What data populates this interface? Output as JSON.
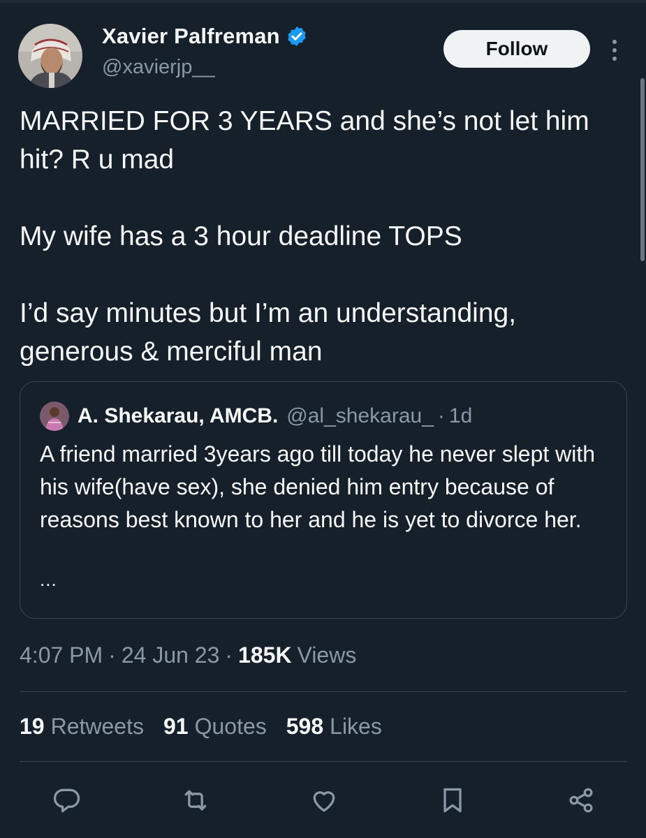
{
  "author": {
    "display_name": "Xavier Palfreman",
    "handle": "@xavierjp__",
    "verified_icon": "verified-badge-icon",
    "avatar": "profile-photo"
  },
  "header": {
    "follow_label": "Follow",
    "more_icon": "more-vertical-icon"
  },
  "tweet": {
    "text": "MARRIED FOR 3 YEARS and she’s not let him hit? R u mad\n\nMy wife has a 3 hour deadline TOPS\n\nI’d say minutes but I’m an understanding, generous & merciful man"
  },
  "quote": {
    "display_name": "A. Shekarau, AMCB.",
    "handle": "@al_shekarau_",
    "separator": "·",
    "time": "1d",
    "text": "A friend married 3years ago till today he never slept with his wife(have sex), she denied him entry because of reasons best known to her and he is yet to divorce her.",
    "ellipsis": "..."
  },
  "meta": {
    "time": "4:07 PM",
    "separator": "·",
    "date": "24 Jun 23",
    "views_count": "185K",
    "views_label": "Views"
  },
  "stats": {
    "retweets_count": "19",
    "retweets_label": "Retweets",
    "quotes_count": "91",
    "quotes_label": "Quotes",
    "likes_count": "598",
    "likes_label": "Likes"
  },
  "actions": [
    "reply-icon",
    "retweet-icon",
    "like-icon",
    "bookmark-icon",
    "share-icon"
  ],
  "colors": {
    "background": "#15202b",
    "text": "#f7f9f9",
    "secondary_text": "#8b98a5",
    "border": "#38444d",
    "verified": "#1d9bf0",
    "follow_button_bg": "#eff3f4"
  }
}
